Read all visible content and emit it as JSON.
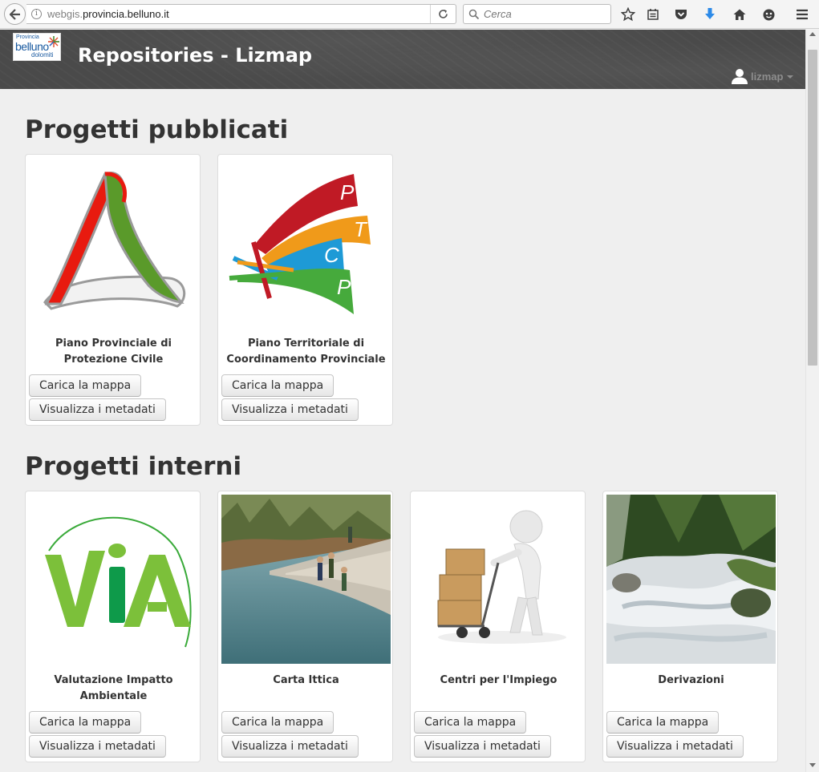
{
  "browser": {
    "url_prefix": "webgis.",
    "url_domain": "provincia.belluno.it",
    "search_placeholder": "Cerca"
  },
  "header": {
    "logo_line1": "Provincia",
    "logo_line2": "belluno",
    "logo_line3": "dolomiti",
    "title": "Repositories - Lizmap",
    "username": "lizmap"
  },
  "sections": [
    {
      "title": "Progetti pubblicati",
      "projects": [
        {
          "name": "Piano Provinciale di Protezione Civile",
          "load_label": "Carica la mappa",
          "meta_label": "Visualizza i metadati",
          "thumbnail": "protezione-civile-logo"
        },
        {
          "name": "Piano Territoriale di Coordinamento Provinciale",
          "load_label": "Carica la mappa",
          "meta_label": "Visualizza i metadati",
          "thumbnail": "ptcp-logo"
        }
      ]
    },
    {
      "title": "Progetti interni",
      "projects": [
        {
          "name": "Valutazione Impatto Ambientale",
          "load_label": "Carica la mappa",
          "meta_label": "Visualizza i metadati",
          "thumbnail": "via-logo"
        },
        {
          "name": "Carta Ittica",
          "load_label": "Carica la mappa",
          "meta_label": "Visualizza i metadati",
          "thumbnail": "river-fishing-photo"
        },
        {
          "name": "Centri per l'Impiego",
          "load_label": "Carica la mappa",
          "meta_label": "Visualizza i metadati",
          "thumbnail": "delivery-figure-image"
        },
        {
          "name": "Derivazioni",
          "load_label": "Carica la mappa",
          "meta_label": "Visualizza i metadati",
          "thumbnail": "mountain-stream-photo"
        }
      ]
    }
  ],
  "colors": {
    "header_bg": "#4a4a4a",
    "page_bg": "#efefef",
    "title_text": "#333333"
  }
}
